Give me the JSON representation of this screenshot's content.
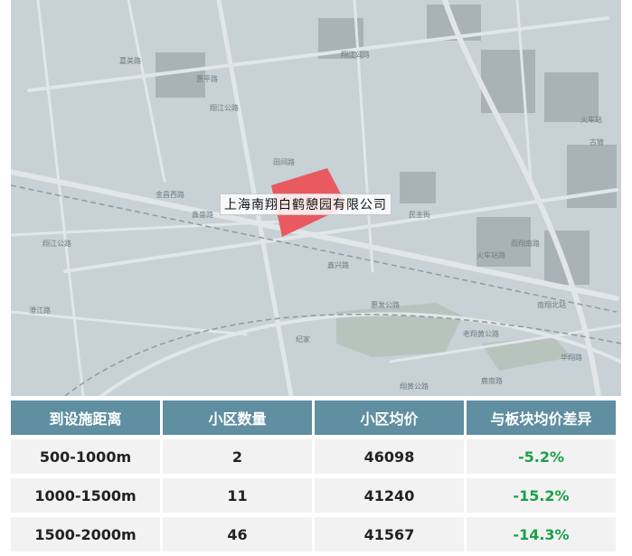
{
  "map": {
    "poi_label": "上海南翔白鹤憩园有限公司",
    "streets": [
      "翔江公路",
      "惠平路",
      "翔江公路",
      "嘉美路",
      "田间路",
      "金昌西路",
      "鑫盛路",
      "鑫兴路",
      "翔江公路",
      "民主街",
      "火车站路",
      "雨翔南路",
      "惠发公路",
      "纪家",
      "翔黄公路",
      "南翔北站",
      "华翔路",
      "老翔黄公路",
      "鹿南路",
      "澄江路",
      "古猗",
      "火车站"
    ]
  },
  "table": {
    "headers": [
      "到设施距离",
      "小区数量",
      "小区均价",
      "与板块均价差异"
    ],
    "rows": [
      {
        "distance": "500-1000m",
        "count": "2",
        "price": "46098",
        "diff": "-5.2%"
      },
      {
        "distance": "1000-1500m",
        "count": "11",
        "price": "41240",
        "diff": "-15.2%"
      },
      {
        "distance": "1500-2000m",
        "count": "46",
        "price": "41567",
        "diff": "-14.3%"
      }
    ]
  },
  "colors": {
    "header_bg": "#5f8fa0",
    "diff_text": "#1aa04a",
    "highlight": "#e85a5f",
    "map_bg": "#c7d1d6"
  }
}
